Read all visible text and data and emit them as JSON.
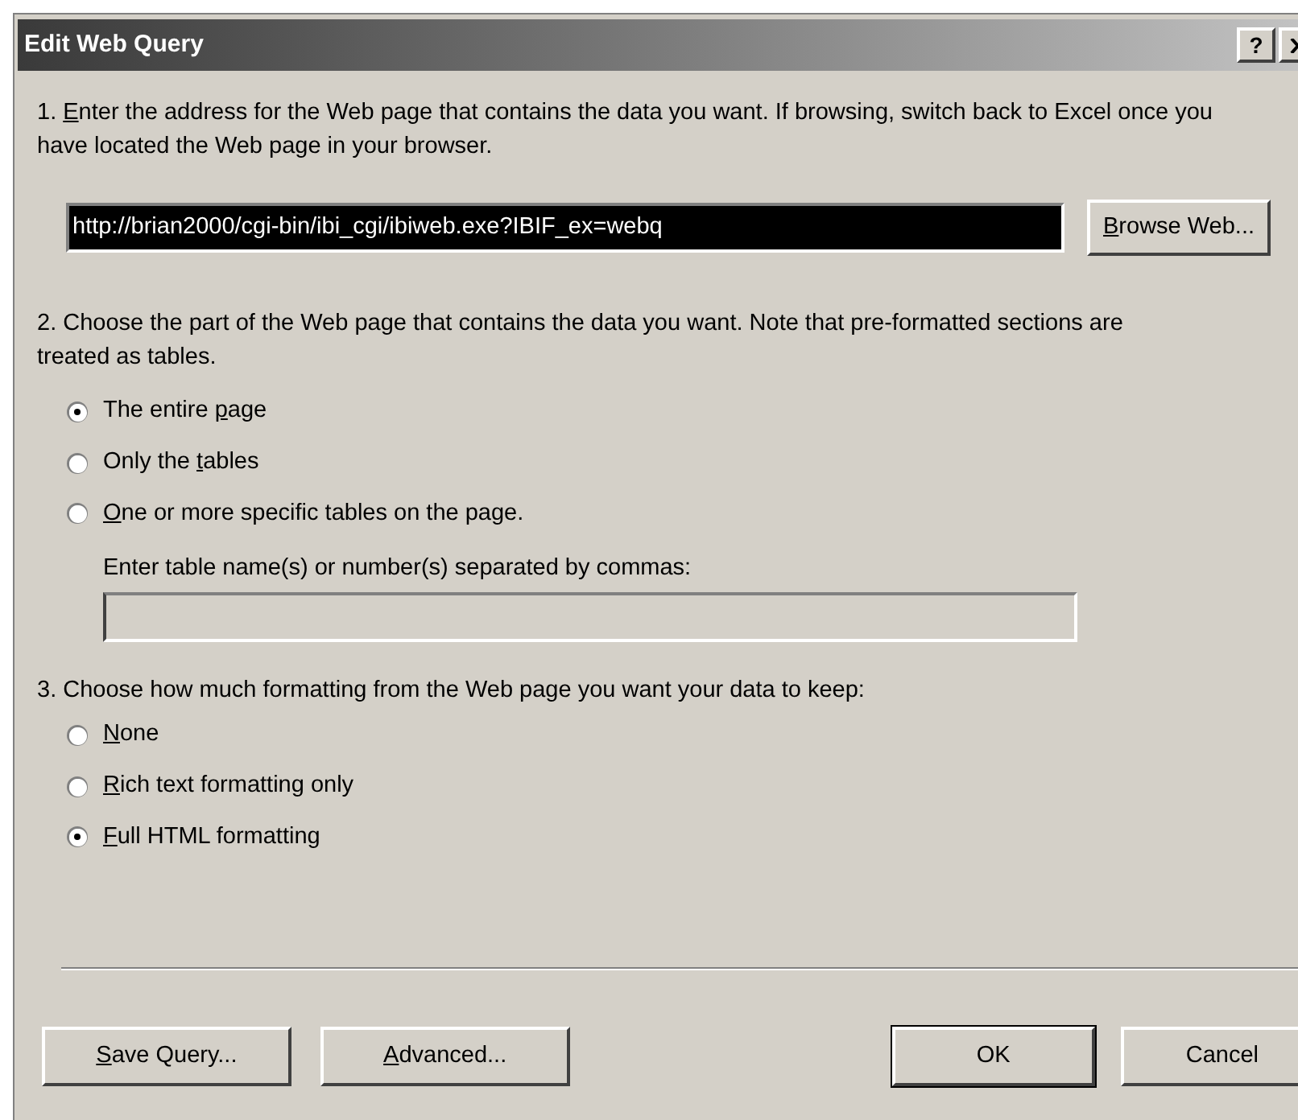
{
  "window": {
    "title": "Edit Web Query",
    "help_button": "?"
  },
  "step1": {
    "text": {
      "before": "1. ",
      "key": "E",
      "after": "nter the address for the Web page that contains the data you want.  If browsing, switch back to Excel once you have located the Web page in your browser."
    }
  },
  "address_field": {
    "value": "http://brian2000/cgi-bin/ibi_cgi/ibiweb.exe?IBIF_ex=webq",
    "selected": true
  },
  "browse_button": {
    "key": "B",
    "after": "rowse Web..."
  },
  "step2": {
    "text": {
      "before": "2. Choose the part of the Web page that contains the data you want.  Note that pre-formatted sections are treated as tables."
    },
    "options": [
      {
        "label": {
          "before": "The entire ",
          "key": "p",
          "after": "age"
        },
        "selected": true
      },
      {
        "label": {
          "before": "Only the ",
          "key": "t",
          "after": "ables"
        },
        "selected": false
      },
      {
        "label": {
          "key": "O",
          "after": "ne or more specific tables on the page."
        },
        "selected": false
      }
    ],
    "tables_label": "Enter table name(s) or number(s) separated by commas:",
    "tables_field": {
      "disabled": true
    }
  },
  "step3": {
    "text": {
      "before": "3. Choose how much formatting from the Web page you want your data to keep:"
    },
    "options": [
      {
        "label": {
          "key": "N",
          "after": "one"
        },
        "selected": false
      },
      {
        "label": {
          "key": "R",
          "after": "ich text formatting only"
        },
        "selected": false
      },
      {
        "label": {
          "key": "F",
          "after": "ull HTML formatting"
        },
        "selected": true
      }
    ]
  },
  "buttons": [
    {
      "label": {
        "key": "S",
        "after": "ave Query..."
      },
      "default": false,
      "kind": "left"
    },
    {
      "label": {
        "key": "A",
        "after": "dvanced..."
      },
      "default": false,
      "kind": "left"
    },
    {
      "label": {
        "before": "OK"
      },
      "default": true,
      "kind": "right"
    },
    {
      "label": {
        "before": "Cancel"
      },
      "default": false,
      "kind": "right"
    }
  ]
}
